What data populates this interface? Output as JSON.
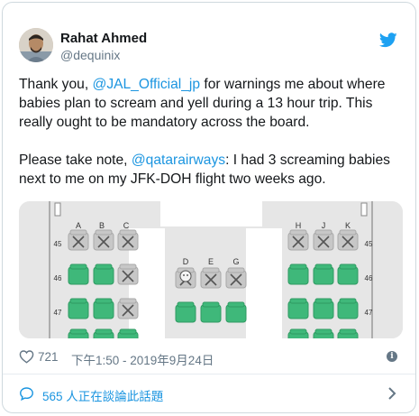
{
  "tweet": {
    "author_name": "Rahat Ahmed",
    "author_handle": "@dequinix",
    "text_1_pre": "Thank you, ",
    "text_1_mention": "@JAL_Official_jp",
    "text_1_post": " for warnings me about where babies plan to scream and yell during a 13 hour trip.  This really ought to be mandatory across the board.",
    "text_2_pre": "Please take note, ",
    "text_2_mention": "@qatarairways",
    "text_2_post": ": I had 3 screaming babies next to me on my JFK-DOH flight two weeks ago.",
    "like_count": "721",
    "timestamp": "下午1:50 - 2019年9月24日",
    "replies_label": "565 人正在談論此話題",
    "info_glyph": "i"
  },
  "seat_map": {
    "left_letters": [
      "A",
      "B",
      "C"
    ],
    "middle_letters": [
      "D",
      "E",
      "G"
    ],
    "right_letters": [
      "H",
      "J",
      "K"
    ],
    "rows": [
      "45",
      "46",
      "47"
    ]
  },
  "colors": {
    "link": "#1b95e0",
    "seat_available": "#3fb87a",
    "seat_taken": "#c7c7c7",
    "aisle": "#ffffff",
    "map_bg": "#e6e6e6"
  },
  "icons": {
    "brand": "twitter-bird-icon",
    "like": "heart-icon",
    "info": "info-icon",
    "replies": "speech-bubble-icon",
    "chevron": "chevron-right-icon",
    "baby": "baby-face-icon",
    "taken": "x-mark-icon"
  }
}
